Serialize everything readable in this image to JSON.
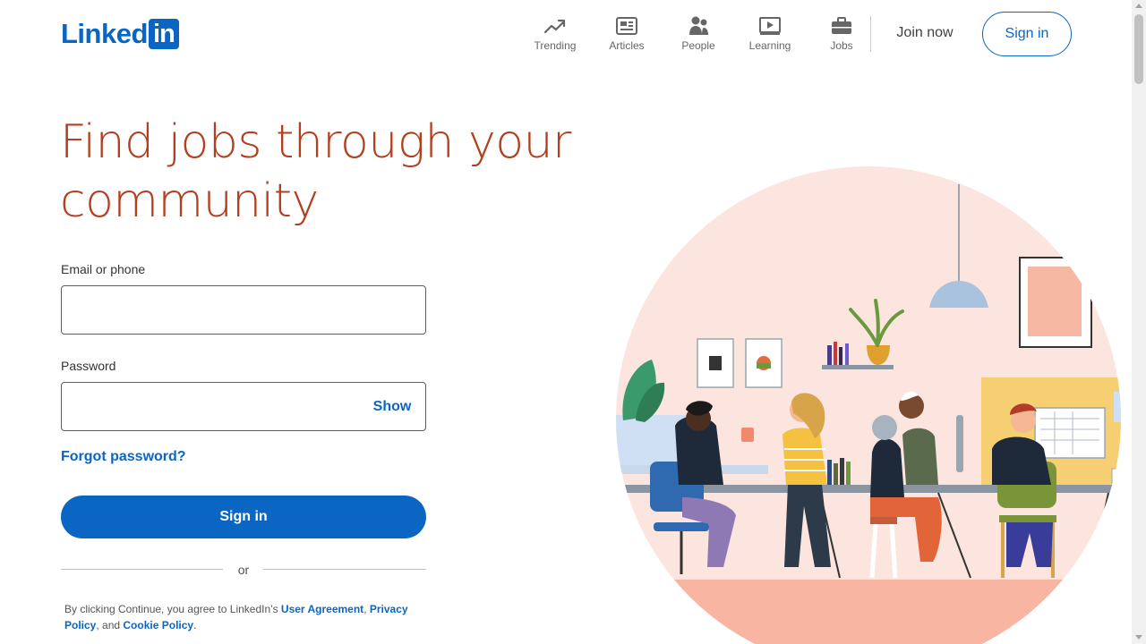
{
  "header": {
    "logo_text": "Linked",
    "logo_box_text": "in",
    "nav": [
      {
        "label": "Trending",
        "icon": "trending-icon"
      },
      {
        "label": "Articles",
        "icon": "articles-icon"
      },
      {
        "label": "People",
        "icon": "people-icon"
      },
      {
        "label": "Learning",
        "icon": "learning-icon"
      },
      {
        "label": "Jobs",
        "icon": "jobs-icon"
      }
    ],
    "join_now": "Join now",
    "sign_in": "Sign in"
  },
  "hero": {
    "headline_line1": "Find jobs through your",
    "headline_line2": "community"
  },
  "form": {
    "email_label": "Email or phone",
    "email_value": "",
    "password_label": "Password",
    "password_value": "",
    "show_label": "Show",
    "forgot_label": "Forgot password?",
    "sign_in_label": "Sign in",
    "or_label": "or"
  },
  "legal": {
    "prefix": "By clicking Continue, you agree to LinkedIn’s ",
    "user_agreement": "User Agreement",
    "sep1": ", ",
    "privacy_policy": "Privacy Policy",
    "sep2": ", and ",
    "cookie_policy": "Cookie Policy",
    "suffix": "."
  },
  "colors": {
    "brand_blue": "#0a66c2",
    "headline": "#b24020",
    "illustration_bg": "#fce4df"
  }
}
